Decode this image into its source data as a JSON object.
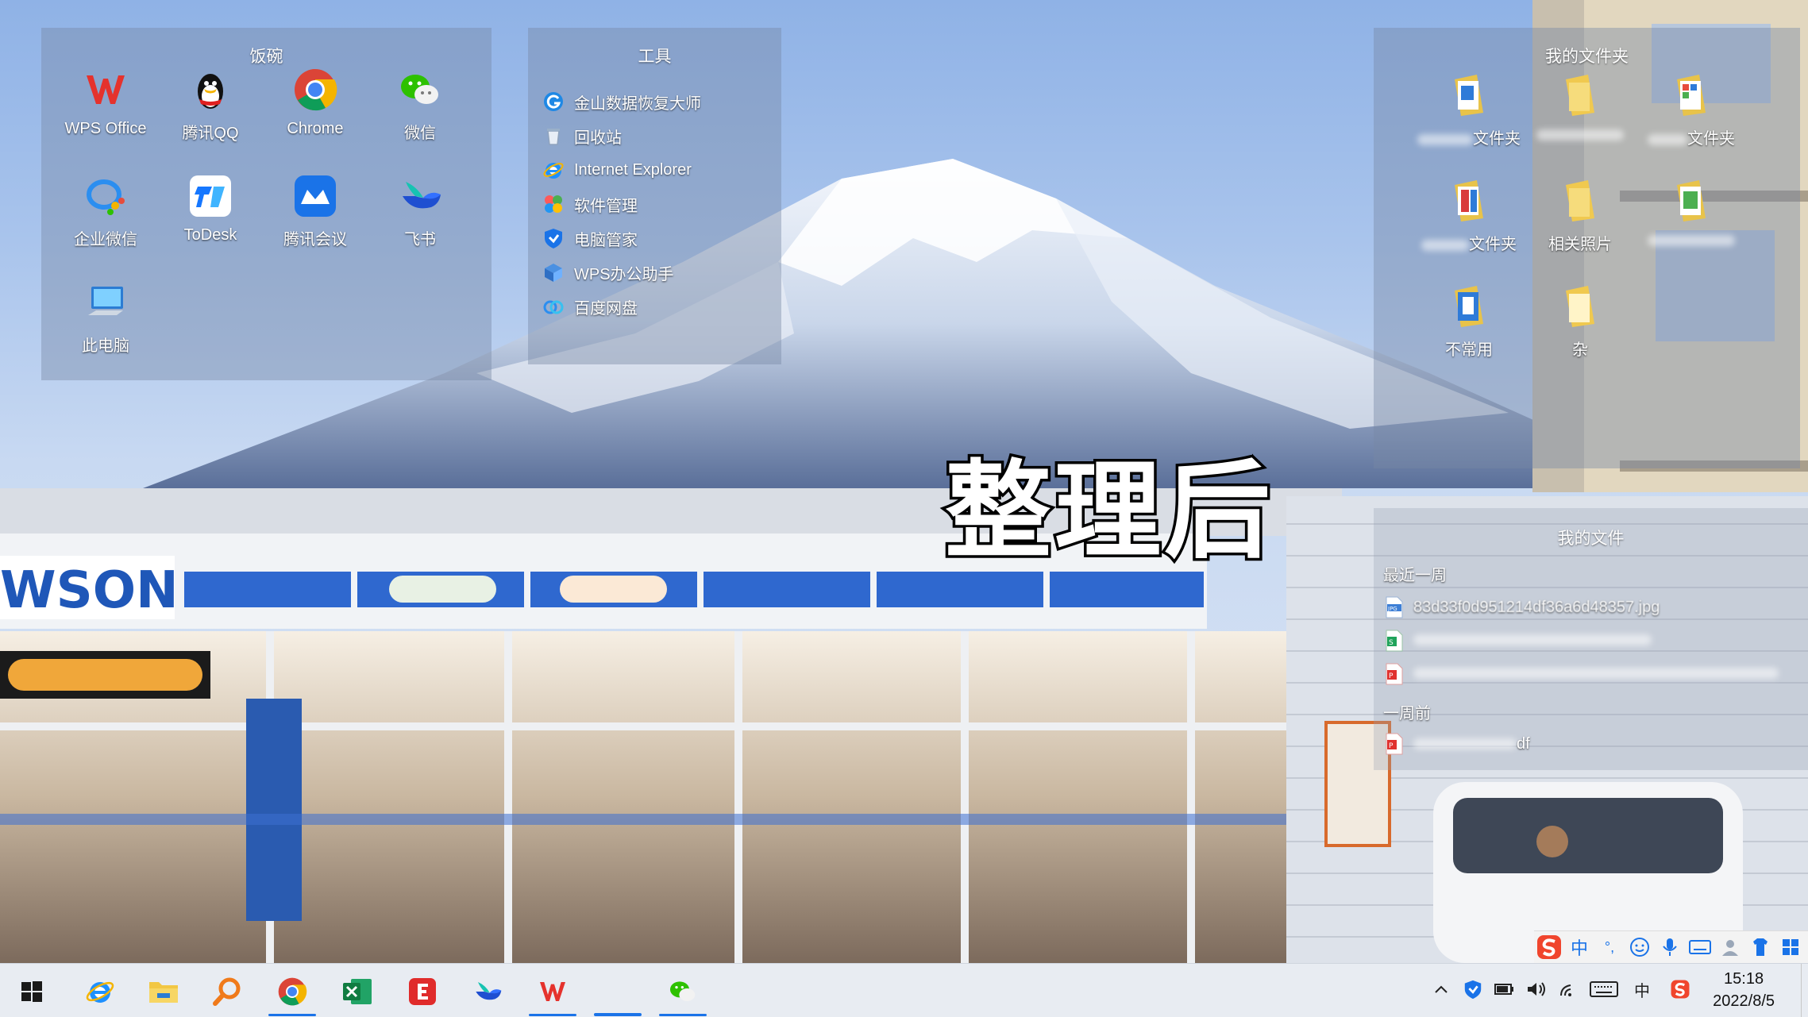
{
  "caption": "整理后",
  "fences": {
    "apps": {
      "title": "饭碗",
      "items": [
        {
          "label": "WPS Office",
          "icon": "wps-icon"
        },
        {
          "label": "腾讯QQ",
          "icon": "qq-icon"
        },
        {
          "label": "Chrome",
          "icon": "chrome-icon"
        },
        {
          "label": "微信",
          "icon": "wechat-icon"
        },
        {
          "label": "企业微信",
          "icon": "wecom-icon"
        },
        {
          "label": "ToDesk",
          "icon": "todesk-icon"
        },
        {
          "label": "腾讯会议",
          "icon": "tencent-meeting-icon"
        },
        {
          "label": "飞书",
          "icon": "feishu-icon"
        },
        {
          "label": "此电脑",
          "icon": "this-pc-icon"
        }
      ]
    },
    "tools": {
      "title": "工具",
      "items": [
        {
          "label": "金山数据恢复大师",
          "icon": "data-recovery-icon"
        },
        {
          "label": "回收站",
          "icon": "recycle-bin-icon"
        },
        {
          "label": "Internet Explorer",
          "icon": "ie-icon"
        },
        {
          "label": "软件管理",
          "icon": "software-manager-icon"
        },
        {
          "label": "电脑管家",
          "icon": "pc-manager-icon"
        },
        {
          "label": "WPS办公助手",
          "icon": "wps-assistant-icon"
        },
        {
          "label": "百度网盘",
          "icon": "baidu-netdisk-icon"
        }
      ]
    },
    "folders": {
      "title": "我的文件夹",
      "items": [
        {
          "label": "文件夹",
          "icon": "folder-doc-icon"
        },
        {
          "label": "",
          "icon": "folder-icon"
        },
        {
          "label": "文件夹",
          "icon": "folder-colorful-icon"
        },
        {
          "label": "文件夹",
          "icon": "folder-red-icon"
        },
        {
          "label": "相关照片",
          "icon": "folder-photo-icon"
        },
        {
          "label": "",
          "icon": "folder-green-icon"
        },
        {
          "label": "不常用",
          "icon": "folder-blue-icon"
        },
        {
          "label": "杂",
          "icon": "folder-plain-icon"
        }
      ]
    },
    "my_files": {
      "title": "我的文件",
      "groups": [
        {
          "heading": "最近一周",
          "files": [
            {
              "label": "83d33f0d951214df36a6d48357.jpg",
              "type": "JPG"
            },
            {
              "label": "",
              "type": "S"
            },
            {
              "label": "",
              "type": "P"
            }
          ]
        },
        {
          "heading": "一周前",
          "files": [
            {
              "label": "df",
              "type": "P"
            }
          ]
        }
      ]
    }
  },
  "ime": {
    "mode": "中",
    "punct": "°,",
    "items": [
      "emoji-icon",
      "mic-icon",
      "keyboard-icon",
      "user-icon",
      "skin-icon",
      "toolbox-icon"
    ]
  },
  "taskbar": {
    "apps": [
      "start-button",
      "ie-icon",
      "file-explorer-icon",
      "search-icon",
      "chrome-icon",
      "excel-icon",
      "everything-icon",
      "feishu-icon",
      "wps-icon",
      "active-window",
      "wechat-icon"
    ],
    "tray_ime": "中",
    "time": "15:18",
    "date": "2022/8/5"
  },
  "colors": {
    "accent": "#1a73e8",
    "fence_bg": "rgba(120,135,165,0.42)"
  }
}
